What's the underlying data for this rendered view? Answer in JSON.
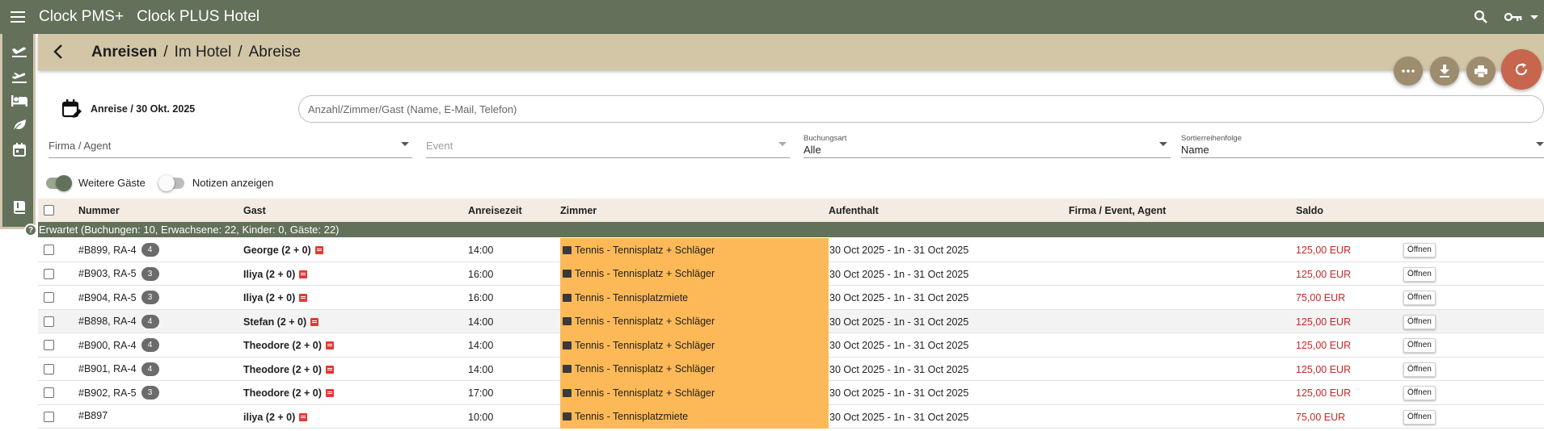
{
  "app": {
    "name": "Clock PMS+",
    "hotel": "Clock PLUS Hotel"
  },
  "breadcrumb": {
    "active": "Anreisen",
    "items": [
      "Im Hotel",
      "Abreise"
    ]
  },
  "date_label": "Anreise / 30 Okt. 2025",
  "search": {
    "placeholder": "Anzahl/Zimmer/Gast (Name, E-Mail, Telefon)"
  },
  "filters": {
    "company": {
      "placeholder": "Firma / Agent"
    },
    "event": {
      "placeholder": "Event"
    },
    "booking_type": {
      "label": "Buchungsart",
      "value": "Alle"
    },
    "sort_order": {
      "label": "Sortierreihenfolge",
      "value": "Name"
    }
  },
  "toggles": {
    "more_guests": {
      "label": "Weitere Gäste",
      "on": true
    },
    "show_notes": {
      "label": "Notizen anzeigen",
      "on": false
    }
  },
  "columns": {
    "number": "Nummer",
    "guest": "Gast",
    "arrival_time": "Anreisezeit",
    "room": "Zimmer",
    "stay": "Aufenthalt",
    "company": "Firma / Event, Agent",
    "balance": "Saldo"
  },
  "group_header": "Erwartet (Buchungen: 10, Erwachsene: 22, Kinder: 0, Gäste: 22)",
  "help_badge": "?",
  "open_label": "Öffnen",
  "rows": [
    {
      "number": "#B899, RA-4",
      "count": "4",
      "guest": "George (2 + 0)",
      "time": "14:00",
      "room": "Tennis - Tennisplatz + Schläger",
      "stay": "30 Oct 2025 - 1n - 31 Oct 2025",
      "balance": "125,00 EUR"
    },
    {
      "number": "#B903, RA-5",
      "count": "3",
      "guest": "Iliya (2 + 0)",
      "time": "16:00",
      "room": "Tennis - Tennisplatz + Schläger",
      "stay": "30 Oct 2025 - 1n - 31 Oct 2025",
      "balance": "125,00 EUR"
    },
    {
      "number": "#B904, RA-5",
      "count": "3",
      "guest": "Iliya (2 + 0)",
      "time": "16:00",
      "room": "Tennis - Tennisplatzmiete",
      "stay": "30 Oct 2025 - 1n - 31 Oct 2025",
      "balance": "75,00 EUR"
    },
    {
      "number": "#B898, RA-4",
      "count": "4",
      "guest": "Stefan (2 + 0)",
      "time": "14:00",
      "room": "Tennis - Tennisplatz + Schläger",
      "stay": "30 Oct 2025 - 1n - 31 Oct 2025",
      "balance": "125,00 EUR"
    },
    {
      "number": "#B900, RA-4",
      "count": "4",
      "guest": "Theodore (2 + 0)",
      "time": "14:00",
      "room": "Tennis - Tennisplatz + Schläger",
      "stay": "30 Oct 2025 - 1n - 31 Oct 2025",
      "balance": "125,00 EUR"
    },
    {
      "number": "#B901, RA-4",
      "count": "4",
      "guest": "Theodore (2 + 0)",
      "time": "14:00",
      "room": "Tennis - Tennisplatz + Schläger",
      "stay": "30 Oct 2025 - 1n - 31 Oct 2025",
      "balance": "125,00 EUR"
    },
    {
      "number": "#B902, RA-5",
      "count": "3",
      "guest": "Theodore (2 + 0)",
      "time": "17:00",
      "room": "Tennis - Tennisplatz + Schläger",
      "stay": "30 Oct 2025 - 1n - 31 Oct 2025",
      "balance": "125,00 EUR"
    },
    {
      "number": "#B897",
      "count": "",
      "guest": "iliya (2 + 0)",
      "time": "10:00",
      "room": "Tennis - Tennisplatzmiete",
      "stay": "30 Oct 2025 - 1n - 31 Oct 2025",
      "balance": "75,00 EUR"
    }
  ],
  "colors": {
    "primary": "#63705a",
    "header": "#d2c6a6",
    "room_highlight": "#fdb957",
    "balance": "#c62828",
    "refresh": "#c7654d"
  },
  "icons": {
    "menu": "menu-icon",
    "search": "search-icon",
    "key": "key-icon",
    "sidebar": [
      "arrivals-icon",
      "departures-icon",
      "bed-icon",
      "leaf-icon",
      "calendar-icon",
      "book-icon"
    ]
  }
}
